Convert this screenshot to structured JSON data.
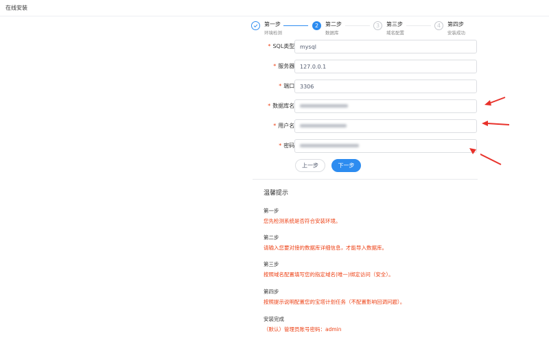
{
  "header": {
    "title": "在线安装"
  },
  "steps": [
    {
      "title": "第一步",
      "desc": "环境检测",
      "status": "done",
      "icon": "check-icon"
    },
    {
      "title": "第二步",
      "desc": "数据库",
      "status": "active",
      "number": "2"
    },
    {
      "title": "第三步",
      "desc": "域名配置",
      "status": "wait",
      "number": "3"
    },
    {
      "title": "第四步",
      "desc": "安装成功",
      "status": "wait",
      "number": "4"
    }
  ],
  "form": {
    "sql_type": {
      "label": "SQL类型:",
      "value": "mysql"
    },
    "server": {
      "label": "服务器:",
      "value": "127.0.0.1"
    },
    "port": {
      "label": "端口:",
      "value": "3306"
    },
    "db_name": {
      "label": "数据库名:",
      "value": ""
    },
    "username": {
      "label": "用户名:",
      "value": ""
    },
    "password": {
      "label": "密码:",
      "value": ""
    }
  },
  "buttons": {
    "prev": "上一步",
    "next": "下一步"
  },
  "tips": {
    "heading": "温馨提示",
    "items": [
      {
        "title": "第一步",
        "desc": "您先检测系统是否符合安装环境。"
      },
      {
        "title": "第二步",
        "desc": "请输入您要对接的数据库详细信息，才能导入数据库。"
      },
      {
        "title": "第三步",
        "desc": "按照域名配置填写您的指定域名(唯一)绑定访问（安全）。"
      },
      {
        "title": "第四步",
        "desc": "按照提示说明配置您的宝塔计划任务（不配置影响回调问题）。"
      },
      {
        "title": "安装完成",
        "desc": "（默认）管理员账号密码：admin"
      }
    ]
  },
  "colors": {
    "primary": "#2d8cf0",
    "required": "#ed4014",
    "annotation": "#e8312a"
  }
}
